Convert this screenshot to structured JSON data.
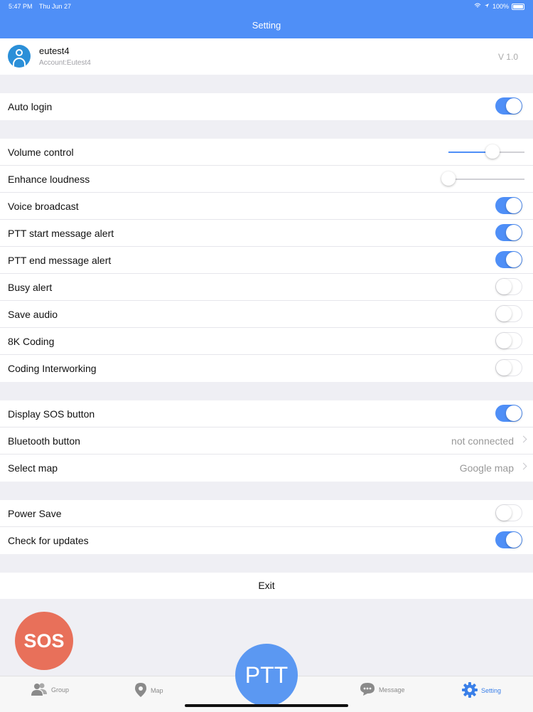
{
  "status_bar": {
    "time": "5:47 PM",
    "date": "Thu Jun 27",
    "battery": "100%"
  },
  "header": {
    "title": "Setting"
  },
  "profile": {
    "username": "eutest4",
    "account": "Account:Eutest4",
    "version": "V 1.0"
  },
  "section1": [
    {
      "label": "Auto login",
      "control": "toggle",
      "on": true
    }
  ],
  "section2": [
    {
      "label": "Volume control",
      "control": "slider",
      "level": 0.58
    },
    {
      "label": "Enhance loudness",
      "control": "slider",
      "level": 0.0
    },
    {
      "label": "Voice broadcast",
      "control": "toggle",
      "on": true
    },
    {
      "label": "PTT start message alert",
      "control": "toggle",
      "on": true
    },
    {
      "label": "PTT end message alert",
      "control": "toggle",
      "on": true
    },
    {
      "label": "Busy alert",
      "control": "toggle",
      "on": false
    },
    {
      "label": "Save audio",
      "control": "toggle",
      "on": false
    },
    {
      "label": "8K Coding",
      "control": "toggle",
      "on": false
    },
    {
      "label": "Coding Interworking",
      "control": "toggle",
      "on": false
    }
  ],
  "section3": [
    {
      "label": "Display SOS button",
      "control": "toggle",
      "on": true
    },
    {
      "label": "Bluetooth button",
      "control": "value",
      "value": "not connected"
    },
    {
      "label": "Select map",
      "control": "value",
      "value": "Google map"
    }
  ],
  "section4": [
    {
      "label": "Power Save",
      "control": "toggle",
      "on": false
    },
    {
      "label": "Check for updates",
      "control": "toggle",
      "on": true
    }
  ],
  "exit_label": "Exit",
  "sos_label": "SOS",
  "ptt_label": "PTT",
  "tabs": [
    {
      "label": "Group",
      "icon": "group-icon"
    },
    {
      "label": "Map",
      "icon": "map-pin-icon"
    },
    {
      "label": "Message",
      "icon": "message-icon"
    },
    {
      "label": "Setting",
      "icon": "gear-icon"
    }
  ],
  "colors": {
    "accent": "#4f8ff7",
    "sos": "#e8705a",
    "ptt": "#5b98f2"
  }
}
